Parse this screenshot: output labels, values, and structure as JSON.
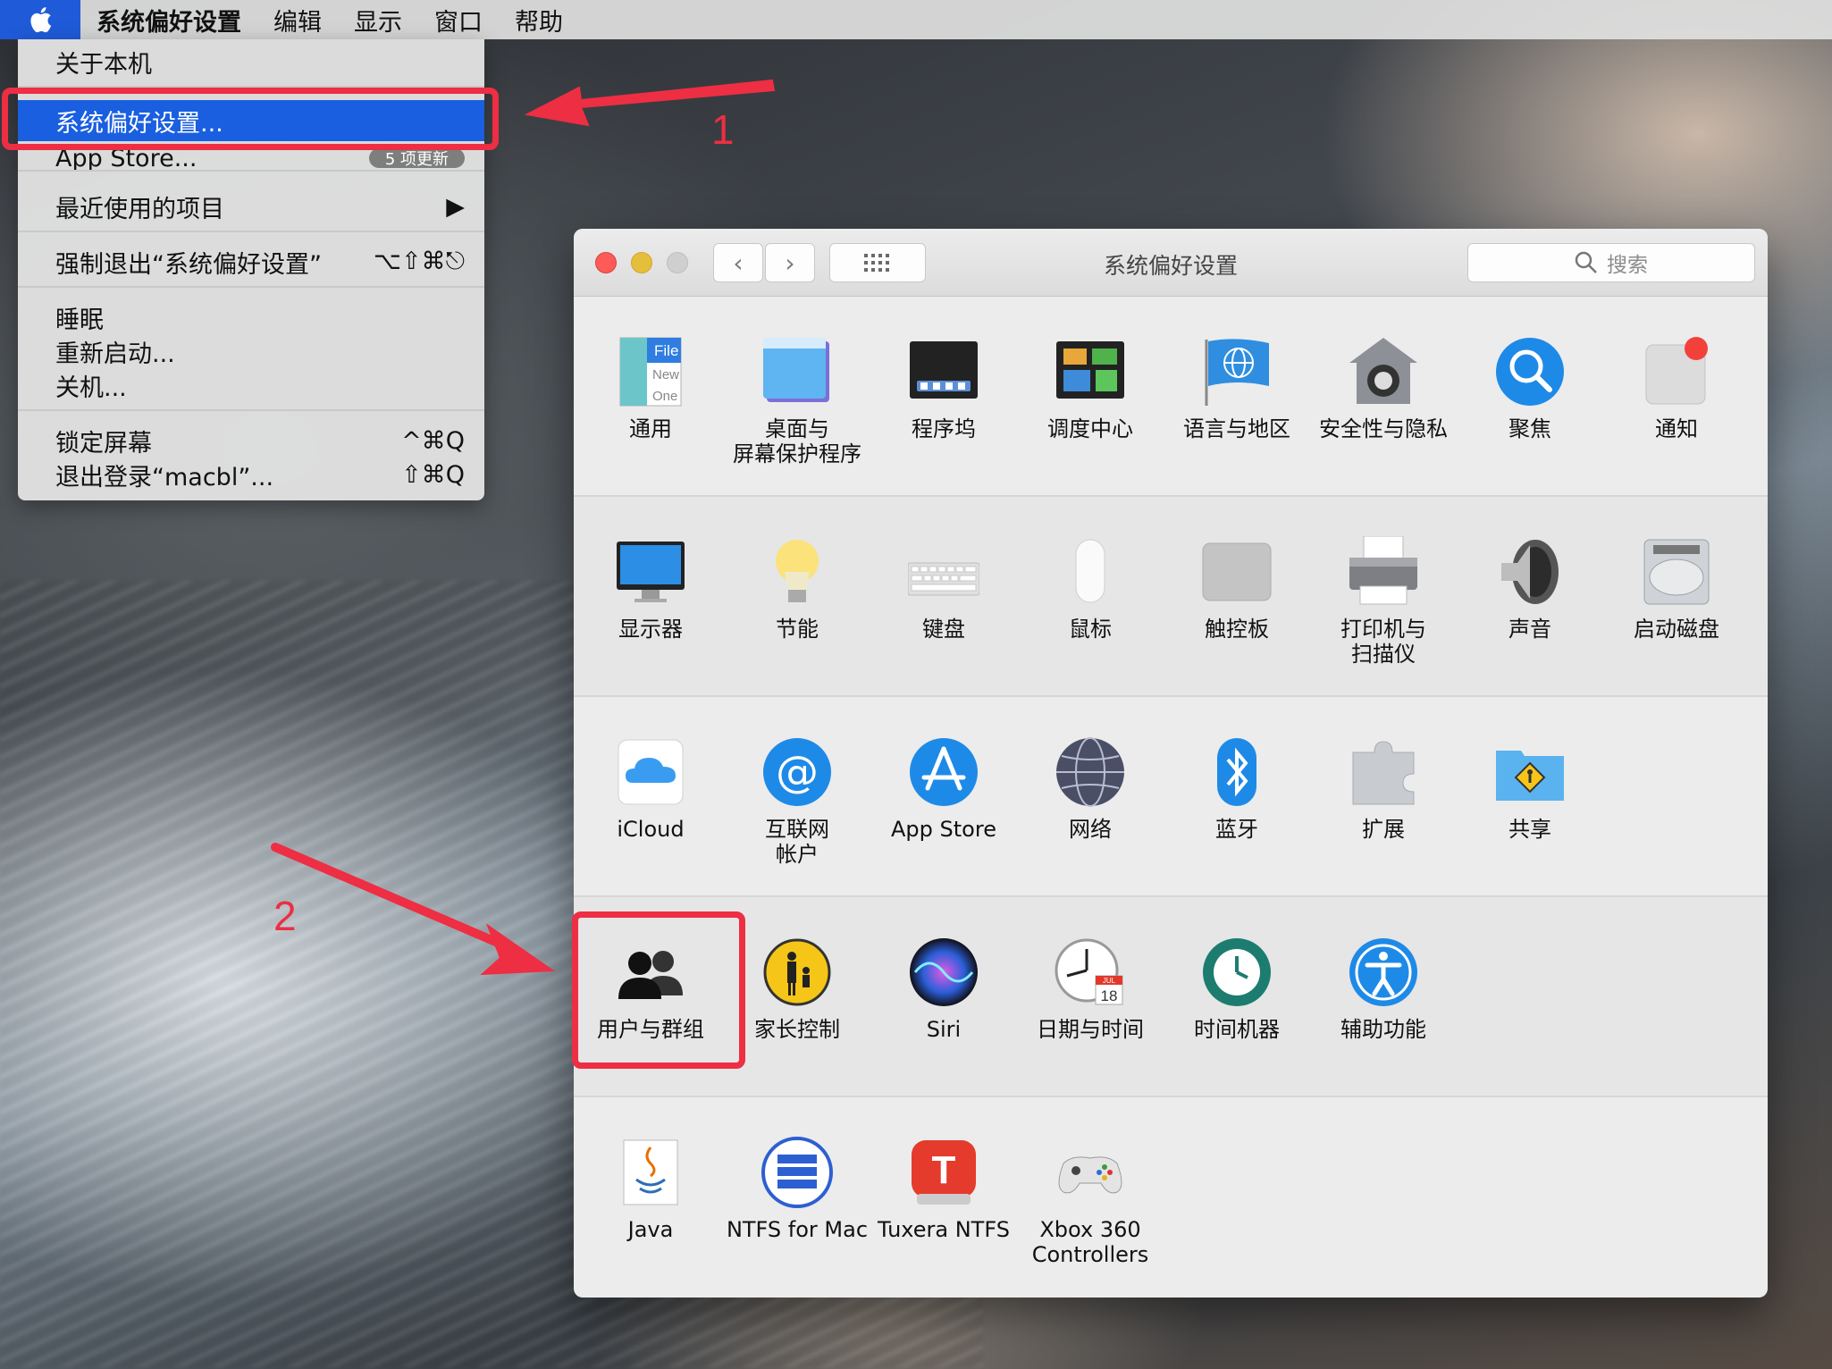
{
  "menubar": {
    "app_name": "系统偏好设置",
    "items": [
      "编辑",
      "显示",
      "窗口",
      "帮助"
    ]
  },
  "apple_menu": {
    "about": "关于本机",
    "system_prefs": "系统偏好设置...",
    "app_store": "App Store...",
    "app_store_badge": "5 项更新",
    "recent_items": "最近使用的项目",
    "force_quit": "强制退出“系统偏好设置”",
    "force_quit_shortcut": "⌥⇧⌘⎋",
    "sleep": "睡眠",
    "restart": "重新启动...",
    "shutdown": "关机...",
    "lock_screen": "锁定屏幕",
    "lock_shortcut": "^⌘Q",
    "logout": "退出登录“macbl”...",
    "logout_shortcut": "⇧⌘Q"
  },
  "annotations": {
    "step1": "1",
    "step2": "2"
  },
  "window": {
    "title": "系统偏好设置",
    "search_placeholder": "搜索",
    "back": "‹",
    "forward": "›",
    "grid": "⠿"
  },
  "panes": {
    "general": "通用",
    "desktop": "桌面与\n屏幕保护程序",
    "dock": "程序坞",
    "mission": "调度中心",
    "language": "语言与地区",
    "security": "安全性与隐私",
    "spotlight": "聚焦",
    "notifications": "通知",
    "displays": "显示器",
    "energy": "节能",
    "keyboard": "键盘",
    "mouse": "鼠标",
    "trackpad": "触控板",
    "printers": "打印机与\n扫描仪",
    "sound": "声音",
    "startup": "启动磁盘",
    "icloud": "iCloud",
    "internet": "互联网\n帐户",
    "appstore": "App Store",
    "network": "网络",
    "bluetooth": "蓝牙",
    "extensions": "扩展",
    "sharing": "共享",
    "users": "用户与群组",
    "parental": "家长控制",
    "siri": "Siri",
    "datetime": "日期与时间",
    "timemachine": "时间机器",
    "accessibility": "辅助功能",
    "java": "Java",
    "ntfs": "NTFS for Mac",
    "tuxera": "Tuxera NTFS",
    "xbox": "Xbox 360\nControllers"
  },
  "icon_text": {
    "general_file": "File",
    "general_new": "New",
    "general_one": "One",
    "calendar_month": "JUL",
    "calendar_day": "18",
    "tuxera_letter": "T"
  },
  "colors": {
    "accent": "#1a5fe0",
    "annotation": "#ee2e43"
  }
}
